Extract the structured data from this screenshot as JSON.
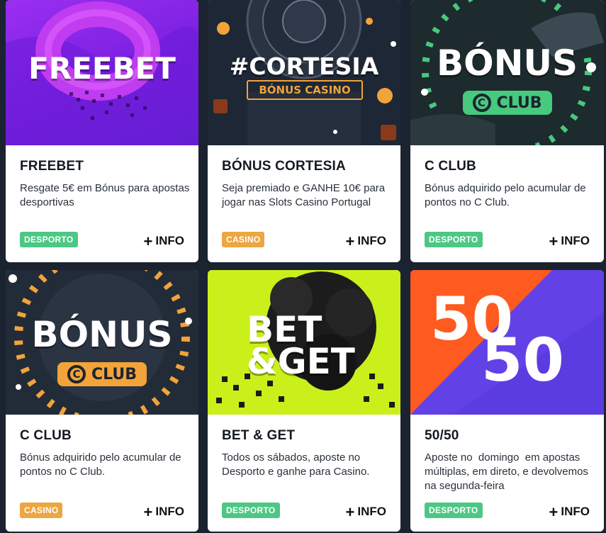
{
  "cards": [
    {
      "banner_text": "FREEBET",
      "title": "FREEBET",
      "description": "Resgate 5€ em Bónus para apostas desportivas",
      "category": "DESPORTO",
      "info_label": "INFO"
    },
    {
      "banner_text": "#CORTESIA",
      "banner_subtext": "BÓNUS CASINO",
      "title": "BÓNUS CORTESIA",
      "description": "Seja premiado e GANHE 10€ para jogar nas Slots Casino Portugal",
      "category": "CASINO",
      "info_label": "INFO"
    },
    {
      "banner_text": "BÓNUS",
      "banner_pill": "CLUB",
      "title": "C CLUB",
      "description": "Bónus adquirido pelo acumular de pontos no C Club.",
      "category": "DESPORTO",
      "info_label": "INFO"
    },
    {
      "banner_text": "BÓNUS",
      "banner_pill": "CLUB",
      "title": "C CLUB",
      "description": "Bónus adquirido pelo acumular de pontos no C Club.",
      "category": "CASINO",
      "info_label": "INFO"
    },
    {
      "banner_line1": "BET",
      "banner_line2": "&GET",
      "title": "BET & GET",
      "description": "Todos os sábados, aposte no Desporto e ganhe para Casino.",
      "category": "DESPORTO",
      "info_label": "INFO"
    },
    {
      "banner_top": "50",
      "banner_bottom": "50",
      "title": "50/50",
      "description": "Aposte no  domingo  em apostas múltiplas, em direto, e devolvemos na segunda-feira",
      "category": "DESPORTO",
      "info_label": "INFO"
    }
  ],
  "colors": {
    "desporto": "#4dc785",
    "casino": "#eca642",
    "page_bg": "#1b2330"
  },
  "icons": {
    "info": "plus-icon",
    "club": "c-logo-icon"
  }
}
